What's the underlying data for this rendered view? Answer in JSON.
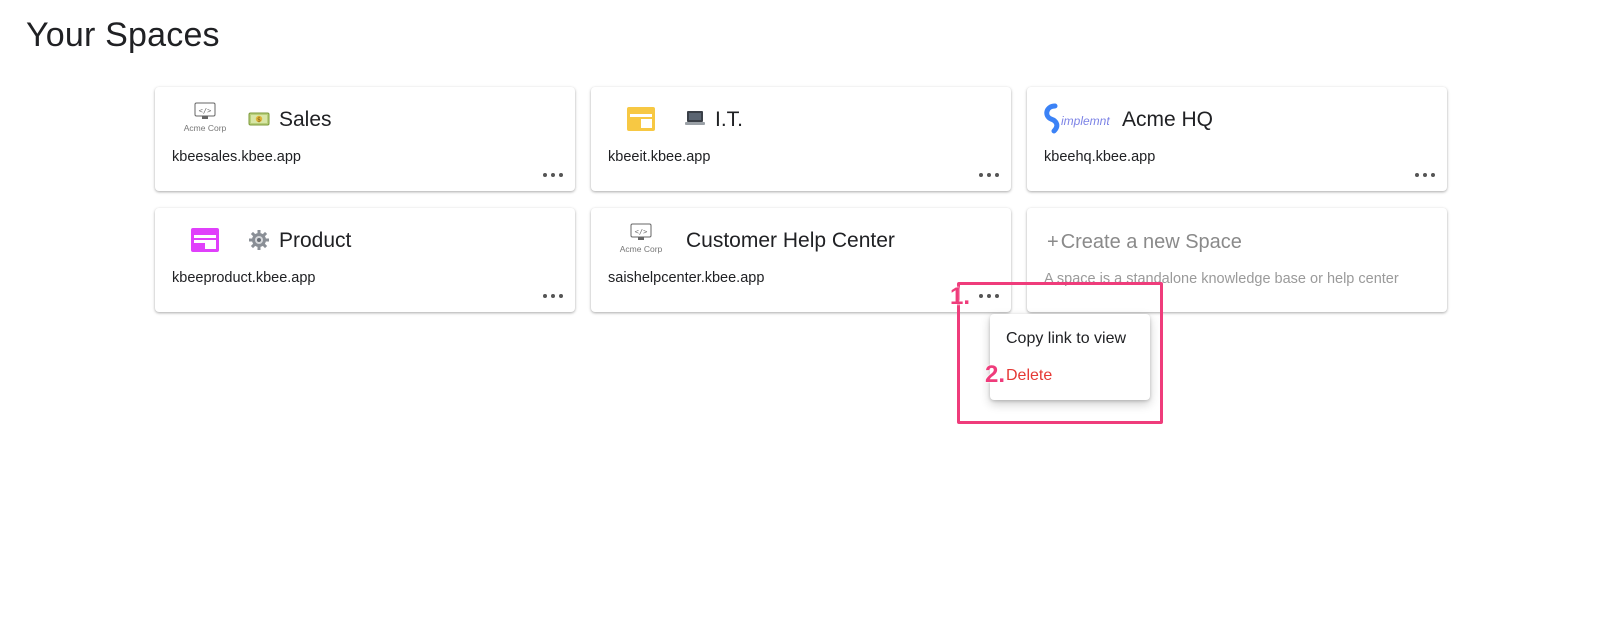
{
  "page": {
    "title": "Your Spaces"
  },
  "spaces": [
    {
      "name": "Sales",
      "url": "kbeesales.kbee.app",
      "logo": "acme-corp-logo",
      "logo_text": "Acme Corp",
      "emoji_icon": "money-icon"
    },
    {
      "name": "I.T.",
      "url": "kbeeit.kbee.app",
      "logo": "layout-icon",
      "logo_color": "#F7C843",
      "emoji_icon": "laptop-icon"
    },
    {
      "name": "Acme HQ",
      "url": "kbeehq.kbee.app",
      "logo": "simplemnt-logo",
      "logo_text": "implemnt",
      "logo_color": "#3b82f6"
    },
    {
      "name": "Product",
      "url": "kbeeproduct.kbee.app",
      "logo": "layout-icon",
      "logo_color": "#E040FB",
      "emoji_icon": "gear-icon"
    },
    {
      "name": "Customer Help Center",
      "url": "saishelpcenter.kbee.app",
      "logo": "acme-corp-logo",
      "logo_text": "Acme Corp"
    }
  ],
  "create": {
    "title": "Create a new Space",
    "description": "A space is a standalone knowledge base or help center"
  },
  "menu": {
    "copy_label": "Copy link to view",
    "delete_label": "Delete"
  },
  "annotations": {
    "step1": "1.",
    "step2": "2."
  },
  "colors": {
    "accent_annotation": "#EF3C7B",
    "danger": "#E53935"
  }
}
